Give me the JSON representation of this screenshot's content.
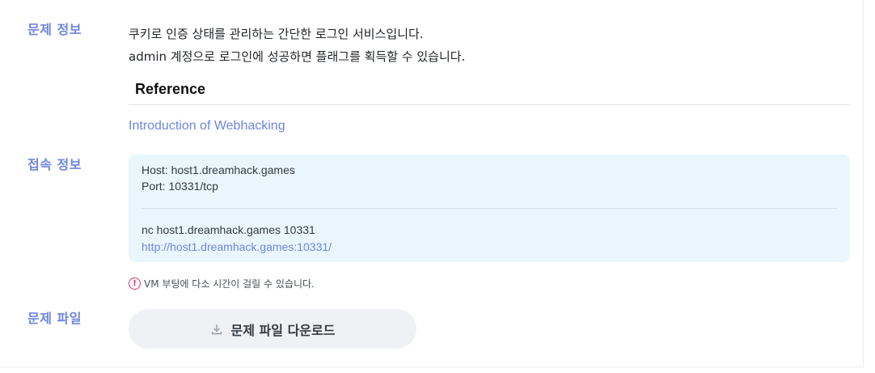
{
  "labels": {
    "problem_info": "문제 정보",
    "connection_info": "접속 정보",
    "problem_file": "문제 파일"
  },
  "description": {
    "line1": "쿠키로 인증 상태를 관리하는 간단한 로그인 서비스입니다.",
    "line2": "admin 계정으로 로그인에 성공하면 플래그를 획득할 수 있습니다."
  },
  "reference": {
    "heading": "Reference",
    "link_text": "Introduction of Webhacking"
  },
  "connection": {
    "host": "Host: host1.dreamhack.games",
    "port": "Port: 10331/tcp",
    "nc_command": "nc host1.dreamhack.games 10331",
    "url": "http://host1.dreamhack.games:10331/"
  },
  "notice": {
    "icon": "exclamation-circle-icon",
    "text": "VM 부팅에 다소 시간이 걸릴 수 있습니다."
  },
  "download": {
    "icon": "download-icon",
    "label": "문제 파일 다운로드"
  },
  "colors": {
    "accent": "#6d86e0",
    "connection_bg": "#eaf6fd",
    "button_bg": "#f0f1f5",
    "notice_icon": "#d6336c"
  }
}
